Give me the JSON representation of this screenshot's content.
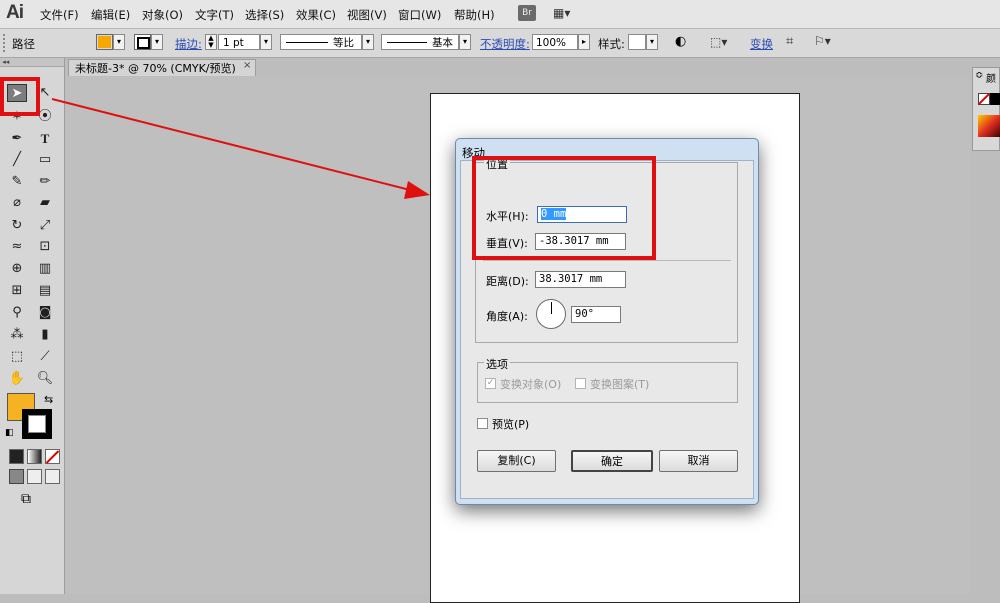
{
  "app": {
    "logo": "Ai",
    "br_label": "Br",
    "workspace_icon": "layout-grid-icon"
  },
  "menu": [
    "文件(F)",
    "编辑(E)",
    "对象(O)",
    "文字(T)",
    "选择(S)",
    "效果(C)",
    "视图(V)",
    "窗口(W)",
    "帮助(H)"
  ],
  "control_bar": {
    "selection_label": "路径",
    "stroke_label": "描边:",
    "stroke_weight": "1 pt",
    "stroke_profile": "等比",
    "brush_label": "基本",
    "opacity_label": "不透明度:",
    "opacity_value": "100%",
    "style_label": "样式:",
    "transform_label": "变换",
    "fill_color": "#f7a800"
  },
  "document": {
    "tab_title": "未标题-3* @ 70% (CMYK/预览)",
    "close_glyph": "×"
  },
  "tools": {
    "fill_color": "#f5b323",
    "stroke_color": "#000000"
  },
  "dialog": {
    "title": "移动",
    "position_group": "位置",
    "horizontal_label": "水平(H):",
    "horizontal_value": "0 mm",
    "vertical_label": "垂直(V):",
    "vertical_value": "-38.3017 mm",
    "distance_label": "距离(D):",
    "distance_value": "38.3017 mm",
    "angle_label": "角度(A):",
    "angle_value": "90°",
    "options_group": "选项",
    "transform_objects": "变换对象(O)",
    "transform_patterns": "变换图案(T)",
    "preview_label": "预览(P)",
    "copy_button": "复制(C)",
    "ok_button": "确定",
    "cancel_button": "取消"
  },
  "right_panel": {
    "label": "颜"
  },
  "annotation": {
    "color": "#e01010"
  }
}
